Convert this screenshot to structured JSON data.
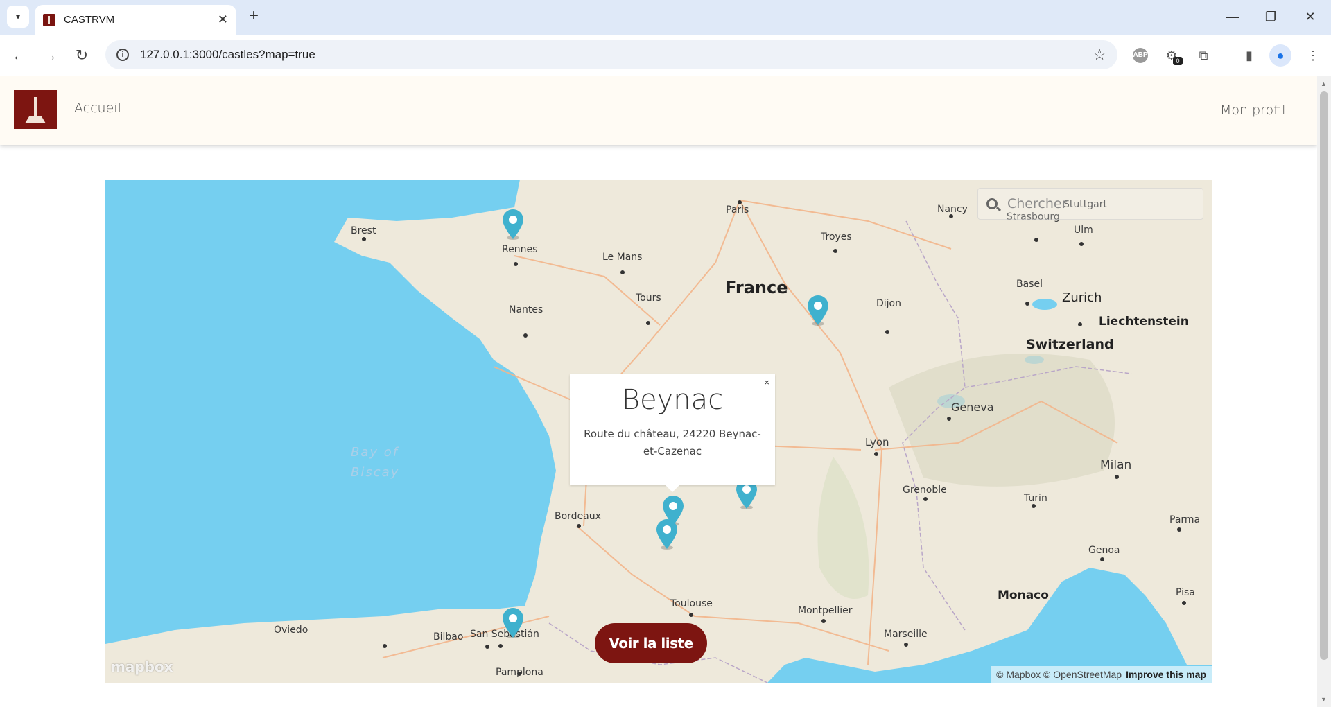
{
  "browser": {
    "tab_title": "CASTRVM",
    "url": "127.0.0.1:3000/castles?map=true",
    "extension_badge": "0"
  },
  "site": {
    "nav_home": "Accueil",
    "nav_profile": "Mon profil"
  },
  "map": {
    "search_placeholder": "Chercher",
    "labels": {
      "paris": "Paris",
      "france": "France",
      "brest": "Brest",
      "rennes": "Rennes",
      "le_mans": "Le Mans",
      "nantes": "Nantes",
      "tours": "Tours",
      "troyes": "Troyes",
      "nancy": "Nancy",
      "stuttgart": "Stuttgart",
      "strasbourg": "Strasbourg",
      "ulm": "Ulm",
      "basel": "Basel",
      "zurich": "Zurich",
      "liechtenstein": "Liechtenstein",
      "switzerland": "Switzerland",
      "dijon": "Dijon",
      "geneva": "Geneva",
      "lyon": "Lyon",
      "grenoble": "Grenoble",
      "milan": "Milan",
      "turin": "Turin",
      "parma": "Parma",
      "genoa": "Genoa",
      "monaco": "Monaco",
      "pisa": "Pisa",
      "bordeaux": "Bordeaux",
      "toulouse": "Toulouse",
      "montpellier": "Montpellier",
      "marseille": "Marseille",
      "oviedo": "Oviedo",
      "bilbao": "Bilbao",
      "san_sebastian": "San Sebastián",
      "pamplona": "Pamplona",
      "bay_of_biscay_1": "Bay of",
      "bay_of_biscay_2": "Biscay"
    },
    "popup": {
      "title": "Beynac",
      "address": "Route du château, 24220 Beynac-et-Cazenac",
      "close": "×"
    },
    "list_button": "Voir la liste",
    "mapbox_logo": "mapbox",
    "attribution": "© Mapbox © OpenStreetMap",
    "improve_link": "Improve this map",
    "marker_color": "#3fb1ce"
  }
}
